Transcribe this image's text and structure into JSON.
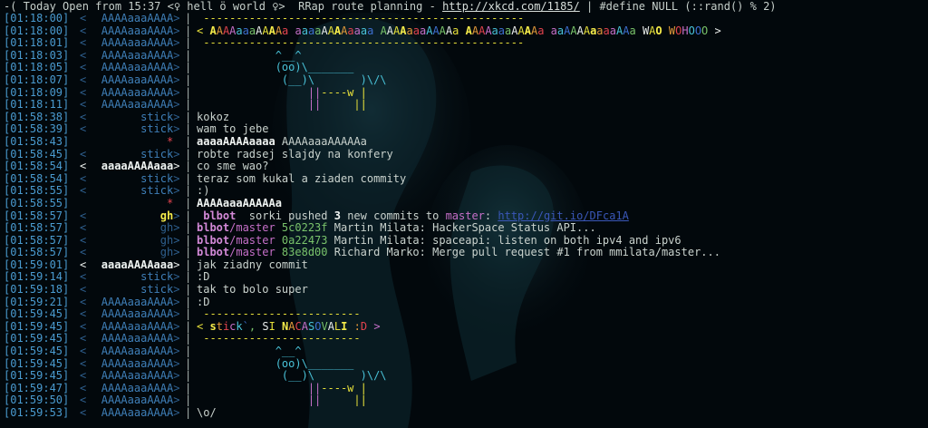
{
  "topic": {
    "prefix": "-( Today Open from 15:37 <♀ hell ö world ♀>  RRap route planning - ",
    "link": "http://xkcd.com/1185/",
    "suffix": " | #define NULL (::rand() % 2)"
  },
  "rows": [
    {
      "ts": "[01:18:00]",
      "nick": "AAAAaaaAAAA",
      "msg": " ------------------------------------------------- ",
      "kind": "dash"
    },
    {
      "ts": "[01:18:00]",
      "nick": "AAAAaaaAAAA",
      "msg": "< AAAAaaaAAAAa aaaaAAAAaaaa AAAAaaaAAAAa AAAAaaaAAAAa aaAAAAaaaaAAa WAO WOHOOO >",
      "kind": "banner1"
    },
    {
      "ts": "[01:18:01]",
      "nick": "AAAAaaaAAAA",
      "msg": " ------------------------------------------------- ",
      "kind": "dash"
    },
    {
      "ts": "[01:18:03]",
      "nick": "AAAAaaaAAAA",
      "msg": "            ^__^",
      "kind": "cow"
    },
    {
      "ts": "[01:18:05]",
      "nick": "AAAAaaaAAAA",
      "msg": "            (oo)\\_______",
      "kind": "cow"
    },
    {
      "ts": "[01:18:07]",
      "nick": "AAAAaaaAAAA",
      "msg": "             (__)\\       )\\/\\",
      "kind": "cow"
    },
    {
      "ts": "[01:18:09]",
      "nick": "AAAAaaaAAAA",
      "msg": "                 ||----w |",
      "kind": "cow2"
    },
    {
      "ts": "[01:18:11]",
      "nick": "AAAAaaaAAAA",
      "msg": "                 ||     ||",
      "kind": "cow2"
    },
    {
      "ts": "[01:58:38]",
      "nick": "stick",
      "msg": "kokoz",
      "kind": "plain"
    },
    {
      "ts": "[01:58:39]",
      "nick": "stick",
      "msg": "wam to jebe",
      "kind": "plain"
    },
    {
      "ts": "[01:58:43]",
      "nick": "*",
      "msg": "aaaaAAAAaaaa AAAAaaaAAAAAa",
      "kind": "action"
    },
    {
      "ts": "[01:58:45]",
      "nick": "stick",
      "msg": "robte radsej slajdy na konfery",
      "kind": "plain"
    },
    {
      "ts": "[01:58:54]",
      "nick": "aaaaAAAAaaa",
      "msg": "co sme wao?",
      "kind": "self"
    },
    {
      "ts": "[01:58:54]",
      "nick": "stick",
      "msg": "teraz som kukal a ziaden commity",
      "kind": "plain"
    },
    {
      "ts": "[01:58:55]",
      "nick": "stick",
      "msg": ":)",
      "kind": "plain"
    },
    {
      "ts": "[01:58:55]",
      "nick": "*",
      "msg": "AAAAaaaAAAAAa",
      "kind": "action2"
    },
    {
      "ts": "[01:58:57]",
      "nick": "gh",
      "msg": " blbot  sorki pushed 3 new commits to master: http://git.io/DFca1A",
      "kind": "gh1"
    },
    {
      "ts": "[01:58:57]",
      "nick": "gh",
      "msg": "blbot/master 5c0223f Martin Milata: HackerSpace Status API...",
      "kind": "gh"
    },
    {
      "ts": "[01:58:57]",
      "nick": "gh",
      "msg": "blbot/master 0a22473 Martin Milata: spaceapi: listen on both ipv4 and ipv6",
      "kind": "gh"
    },
    {
      "ts": "[01:58:57]",
      "nick": "gh",
      "msg": "blbot/master 83e8d00 Richard Marko: Merge pull request #1 from mmilata/master...",
      "kind": "gh"
    },
    {
      "ts": "[01:59:01]",
      "nick": "aaaaAAAAaaa",
      "msg": "jak ziadny commit",
      "kind": "self"
    },
    {
      "ts": "[01:59:14]",
      "nick": "stick",
      "msg": ":D",
      "kind": "plain"
    },
    {
      "ts": "[01:59:18]",
      "nick": "stick",
      "msg": "tak to bolo super",
      "kind": "plain"
    },
    {
      "ts": "[01:59:21]",
      "nick": "AAAAaaaAAAA",
      "msg": ":D",
      "kind": "plain"
    },
    {
      "ts": "[01:59:45]",
      "nick": "AAAAaaaAAAA",
      "msg": " ------------------------ ",
      "kind": "dash"
    },
    {
      "ts": "[01:59:45]",
      "nick": "AAAAaaaAAAA",
      "msg": "< stick`, SI NACASOVALI :D >",
      "kind": "banner2"
    },
    {
      "ts": "[01:59:45]",
      "nick": "AAAAaaaAAAA",
      "msg": " ------------------------ ",
      "kind": "dash"
    },
    {
      "ts": "[01:59:45]",
      "nick": "AAAAaaaAAAA",
      "msg": "            ^__^",
      "kind": "cow"
    },
    {
      "ts": "[01:59:45]",
      "nick": "AAAAaaaAAAA",
      "msg": "            (oo)\\_______",
      "kind": "cow"
    },
    {
      "ts": "[01:59:45]",
      "nick": "AAAAaaaAAAA",
      "msg": "             (__)\\       )\\/\\",
      "kind": "cow"
    },
    {
      "ts": "[01:59:47]",
      "nick": "AAAAaaaAAAA",
      "msg": "                 ||----w |",
      "kind": "cow2"
    },
    {
      "ts": "[01:59:50]",
      "nick": "AAAAaaaAAAA",
      "msg": "                 ||     ||",
      "kind": "cow2"
    },
    {
      "ts": "[01:59:53]",
      "nick": "AAAAaaaAAAA",
      "msg": "\\o/",
      "kind": "plain"
    }
  ],
  "colors": {
    "background": "#02080c",
    "timestamp": "#4a9bd0",
    "nick": "#3f7fb8",
    "self_nick": "#f0f4f2",
    "gh_nick": "#e6e03a",
    "link": "#3a57b8"
  }
}
